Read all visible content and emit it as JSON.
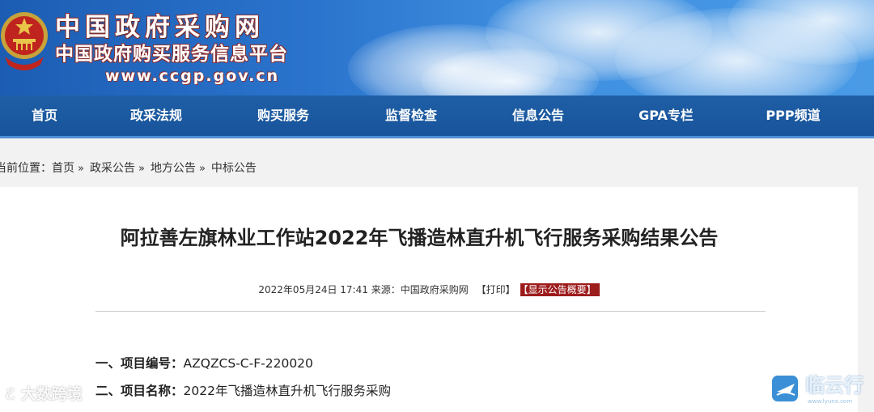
{
  "header": {
    "site_title": "中国政府采购网",
    "site_subtitle": "中国政府购买服务信息平台",
    "site_url": "www.ccgp.gov.cn"
  },
  "nav": {
    "items": [
      {
        "label": "首页"
      },
      {
        "label": "政采法规"
      },
      {
        "label": "购买服务"
      },
      {
        "label": "监督检查"
      },
      {
        "label": "信息公告"
      },
      {
        "label": "GPA专栏"
      },
      {
        "label": "PPP频道"
      }
    ]
  },
  "breadcrumb": {
    "prefix": "当前位置：",
    "items": [
      "首页",
      "政采公告",
      "地方公告",
      "中标公告"
    ],
    "separator": "»"
  },
  "article": {
    "title": "阿拉善左旗林业工作站2022年飞播造林直升机飞行服务采购结果公告",
    "meta": {
      "date": "2022年05月24日 17:41",
      "source_label": "来源：",
      "source": "中国政府采购网",
      "print_link": "【打印】",
      "summary_link": "【显示公告概要】"
    },
    "fields": [
      {
        "label": "一、项目编号：",
        "value": "AZQZCS-C-F-220020"
      },
      {
        "label": "二、项目名称：",
        "value": "2022年飞播造林直升机飞行服务采购"
      }
    ]
  },
  "watermarks": {
    "left": "大数跨境",
    "right": "临云行",
    "right_url": "www.lyunx.com"
  },
  "colors": {
    "nav_bg": "#1f5fa6",
    "banner_bg": "#2a73cc",
    "summary_bg": "#9d1c1c"
  }
}
